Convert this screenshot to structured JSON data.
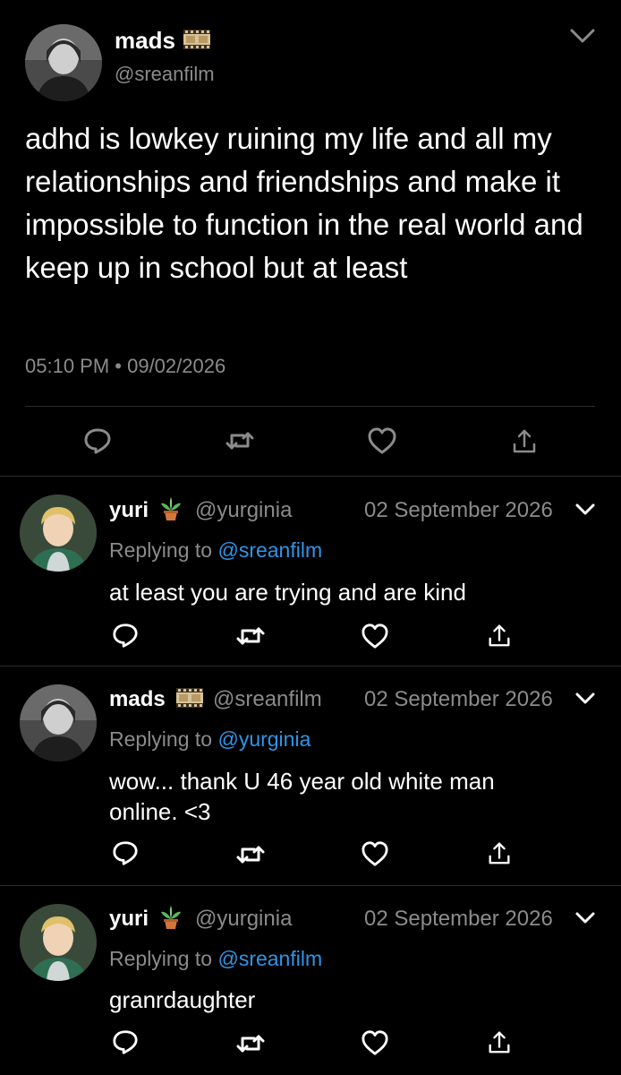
{
  "main_tweet": {
    "name": "mads",
    "name_emoji": "film-frames-icon",
    "handle": "@sreanfilm",
    "text": "adhd is lowkey ruining my life and all my relationships and friendships and make it impossible to function in the real world and keep up in school but at least",
    "timestamp": "05:10 PM • 09/02/2026"
  },
  "replies": [
    {
      "name": "yuri",
      "name_emoji": "potted-plant-icon",
      "handle": "@yurginia",
      "date": "02 September 2026",
      "replying_prefix": "Replying to",
      "replying_to": "@sreanfilm",
      "text": "at least you are trying and are kind"
    },
    {
      "name": "mads",
      "name_emoji": "film-frames-icon",
      "handle": "@sreanfilm",
      "date": "02 September 2026",
      "replying_prefix": "Replying to",
      "replying_to": "@yurginia",
      "text": "wow... thank U 46 year old white man online. <3"
    },
    {
      "name": "yuri",
      "name_emoji": "potted-plant-icon",
      "handle": "@yurginia",
      "date": "02 September 2026",
      "replying_prefix": "Replying to",
      "replying_to": "@sreanfilm",
      "text": "granrdaughter"
    }
  ],
  "actions": [
    "reply-icon",
    "retweet-icon",
    "like-icon",
    "share-icon"
  ],
  "colors": {
    "background": "#000000",
    "text": "#ffffff",
    "muted": "#8b8b8b",
    "link": "#2f95e8",
    "divider": "#2c2c2c"
  }
}
